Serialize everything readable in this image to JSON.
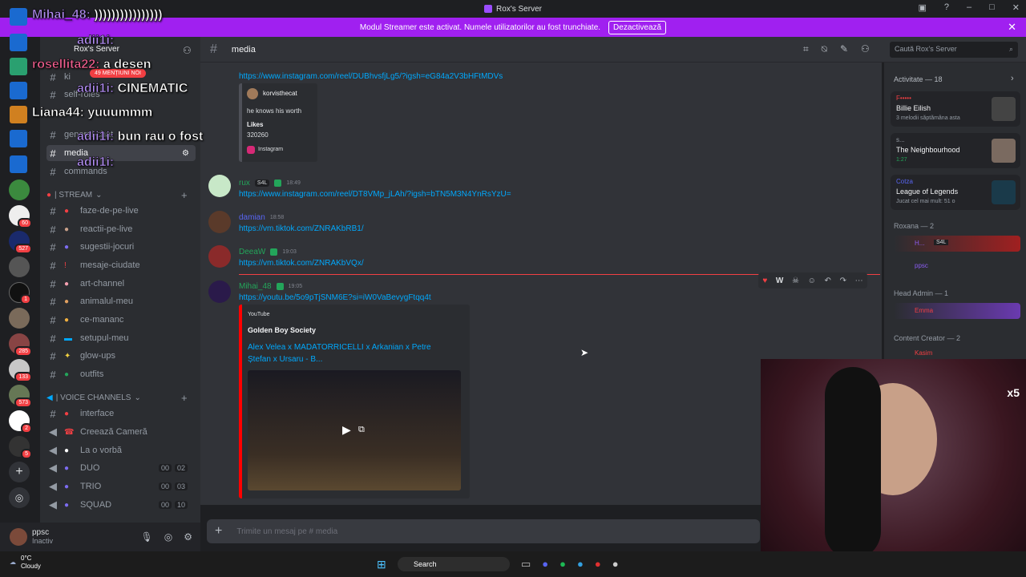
{
  "window": {
    "title": "Rox's Server"
  },
  "banner": {
    "text": "Modul Streamer este activat. Numele utilizatorilor au fost trunchiate.",
    "button": "Dezactivează"
  },
  "server": {
    "name": "Rox's Server",
    "mentions": "49 MENȚIUNI NOI"
  },
  "sidebar": {
    "top_channels": [
      {
        "label": "ki"
      },
      {
        "label": "self-roles"
      },
      {
        "label": "general-chat"
      },
      {
        "label": "media"
      },
      {
        "label": "commands"
      }
    ],
    "stream_category": "| STREAM",
    "stream_channels": [
      {
        "label": "faze-de-pe-live"
      },
      {
        "label": "reactii-pe-live"
      },
      {
        "label": "sugestii-jocuri"
      },
      {
        "label": "mesaje-ciudate"
      },
      {
        "label": "art-channel"
      },
      {
        "label": "animalul-meu"
      },
      {
        "label": "ce-mananc"
      },
      {
        "label": "setupul-meu"
      },
      {
        "label": "glow-ups"
      },
      {
        "label": "outfits"
      }
    ],
    "voice_category": "| VOICE CHANNELS",
    "voice_channels": [
      {
        "label": "interface"
      },
      {
        "label": "Creează Cameră"
      },
      {
        "label": "La o vorbă"
      },
      {
        "label": "DUO",
        "c1": "00",
        "c2": "02"
      },
      {
        "label": "TRIO",
        "c1": "00",
        "c2": "03"
      },
      {
        "label": "SQUAD",
        "c1": "00",
        "c2": "10"
      }
    ]
  },
  "guild_badges": [
    "60",
    "527",
    "1",
    "285",
    "133",
    "573",
    "2",
    "5"
  ],
  "user": {
    "name": "ppsc",
    "status": "Inactiv"
  },
  "header": {
    "channel": "media",
    "search_placeholder": "Caută Rox's Server"
  },
  "messages": {
    "m0_link": "https://www.instagram.com/reel/DUBhvsfjLg5/?igsh=eG84a2V3bHFtMDVs",
    "embed0": {
      "author": "korvisthecat",
      "desc": "he knows his worth",
      "likes_label": "Likes",
      "likes": "320260",
      "provider": "Instagram"
    },
    "m1": {
      "author": "rux",
      "tag": "S4L",
      "time": "18:49",
      "link": "https://www.instagram.com/reel/DT8VMp_jLAh/?igsh=bTN5M3N4YnRsYzU="
    },
    "m2": {
      "author": "damian",
      "time": "18:58",
      "link": "https://vm.tiktok.com/ZNRAKbRB1/"
    },
    "m3": {
      "author": "DeeaW",
      "time": "19:03",
      "link": "https://vm.tiktok.com/ZNRAKbVQx/"
    },
    "m4": {
      "author": "Mihai_48",
      "time": "19:05",
      "link": "https://youtu.be/5o9pTjSNM6E?si=iW0VaBevygFtqq4t",
      "provider": "YouTube",
      "channel": "Golden Boy Society",
      "title": "Alex Velea x MADATORRICELLI x Arkanian x Petre Ștefan x Ursaru - B..."
    },
    "reaction_w": "W"
  },
  "input": {
    "placeholder": "Trimite un mesaj pe #",
    "channel": "media"
  },
  "activity": {
    "header": "Activitate — 18",
    "cards": [
      {
        "user": "F•••••",
        "title": "Billie Eilish",
        "sub": "3 melodii săptămâna asta"
      },
      {
        "user": "s...",
        "title": "The Neighbourhood",
        "sub": "1:27"
      },
      {
        "user": "Cotza",
        "title": "League of Legends",
        "sub": "Jucat cel mai mult: 51 o"
      }
    ],
    "groups": [
      {
        "label": "Roxana — 2"
      },
      {
        "label": "Head Admin — 1"
      },
      {
        "label": "Content Creator — 2"
      }
    ],
    "members": [
      {
        "name": "H...",
        "tag": "S4L"
      },
      {
        "name": "ppsc"
      },
      {
        "name": "Emma"
      },
      {
        "name": "Kasim"
      }
    ]
  },
  "cam": {
    "multiplier": "x5"
  },
  "taskbar": {
    "temp": "0°C",
    "weather": "Cloudy",
    "search": "Search"
  },
  "twitch_chat": [
    {
      "name": "Mihai_48:",
      "text": " ))))))))))))))))"
    },
    {
      "name": "adii1i:",
      "text": ""
    },
    {
      "name": "rosellita22:",
      "text": " a desen"
    },
    {
      "name": "adii1i:",
      "text": " CINEMATIC"
    },
    {
      "name": "Liana44:",
      "text": " yuuummm"
    },
    {
      "name": "adii1i:",
      "text": " bun rau o fost"
    },
    {
      "name": "adii1i:",
      "text": ""
    }
  ],
  "colors": {
    "banner": "#a020f0",
    "link": "#00a8fc",
    "accent_green": "#23a55a",
    "embed_youtube": "#ff0000"
  }
}
